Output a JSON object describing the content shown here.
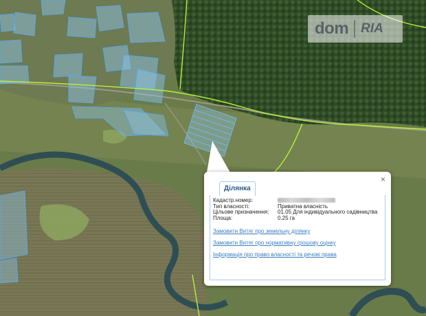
{
  "brand": {
    "left": "dom",
    "right": "RIA"
  },
  "popup": {
    "tab_label": "Ділянка",
    "close_glyph": "×",
    "fields": [
      {
        "label": "Кадастр.номер:",
        "value": "",
        "blurred": true
      },
      {
        "label": "Тип власності:",
        "value": "Приватна власність"
      },
      {
        "label": "Цільове призначення:",
        "value": "01.05 Для індивідуального садівництва"
      },
      {
        "label": "Площа:",
        "value": "0.25 га"
      }
    ],
    "links": [
      "Замовити Витяг про земельну ділянку",
      "Замовити Витяг про нормативну грошову оцінку",
      "Інформація про право власності та речові права"
    ]
  },
  "colors": {
    "parcel_fill": "#8ec8f0",
    "parcel_stroke": "#5aa6e6",
    "boundary_line": "#b8f03a",
    "river": "#2f4e54",
    "link": "#3a7dc0"
  }
}
